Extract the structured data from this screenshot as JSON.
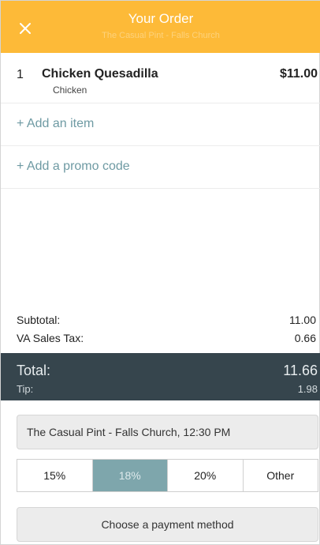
{
  "header": {
    "title": "Your Order",
    "subtitle": "The Casual Pint - Falls Church",
    "close_icon": "close-icon",
    "background_color": "#fdba38"
  },
  "order": {
    "items": [
      {
        "quantity": "1",
        "name": "Chicken Quesadilla",
        "option": "Chicken",
        "price": "$11.00"
      }
    ],
    "add_item_label": "+ Add an item",
    "add_promo_label": "+ Add a promo code"
  },
  "summary": {
    "subtotal_label": "Subtotal:",
    "subtotal_value": "11.00",
    "tax_label": "VA Sales Tax:",
    "tax_value": "0.66",
    "total_label": "Total:",
    "total_value": "11.66",
    "tip_label": "Tip:",
    "tip_value": "1.98"
  },
  "pickup": {
    "location_time": "The Casual Pint - Falls Church, 12:30 PM"
  },
  "tip_options": {
    "options": [
      "15%",
      "18%",
      "20%",
      "Other"
    ],
    "selected": "18%"
  },
  "payment": {
    "button_label": "Choose a payment method"
  },
  "colors": {
    "accent": "#fdba38",
    "link": "#6e9aa3",
    "total_panel": "#36454d",
    "tip_selected": "#7ea6ac"
  }
}
